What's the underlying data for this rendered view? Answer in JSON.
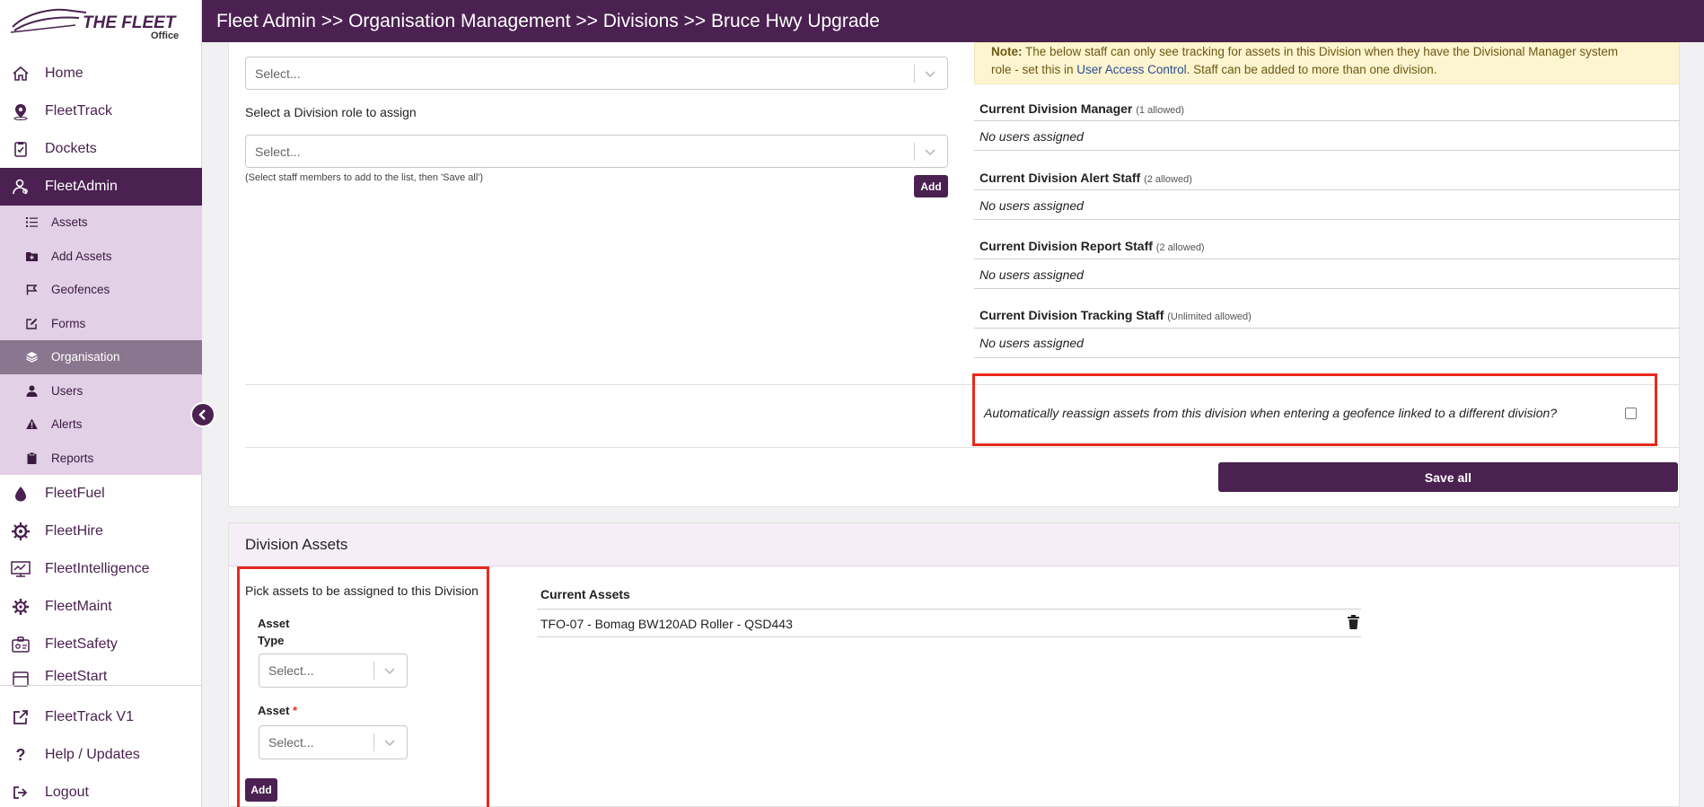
{
  "app": {
    "logo_text": "THE FLEET",
    "logo_sub": "Office"
  },
  "header": {
    "breadcrumb": "Fleet Admin >> Organisation Management >> Divisions >> Bruce Hwy Upgrade"
  },
  "sidebar": {
    "items": [
      {
        "label": "Home",
        "icon": "home-icon"
      },
      {
        "label": "FleetTrack",
        "icon": "map-pin-icon"
      },
      {
        "label": "Dockets",
        "icon": "clipboard-icon"
      },
      {
        "label": "FleetAdmin",
        "icon": "admin-user-icon"
      }
    ],
    "sub_items": [
      {
        "label": "Assets",
        "icon": "list-icon"
      },
      {
        "label": "Add Assets",
        "icon": "folder-plus-icon"
      },
      {
        "label": "Geofences",
        "icon": "flag-icon"
      },
      {
        "label": "Forms",
        "icon": "edit-icon"
      },
      {
        "label": "Organisation",
        "icon": "layers-icon"
      },
      {
        "label": "Users",
        "icon": "user-icon"
      },
      {
        "label": "Alerts",
        "icon": "warning-icon"
      },
      {
        "label": "Reports",
        "icon": "clipboard-solid-icon"
      }
    ],
    "products": [
      {
        "label": "FleetFuel",
        "icon": "fuel-drop-icon"
      },
      {
        "label": "FleetHire",
        "icon": "hire-gear-icon"
      },
      {
        "label": "FleetIntelligence",
        "icon": "monitor-chart-icon"
      },
      {
        "label": "FleetMaint",
        "icon": "cog-icon"
      },
      {
        "label": "FleetSafety",
        "icon": "safety-badge-icon"
      },
      {
        "label": "FleetStart",
        "icon": "start-calendar-icon"
      }
    ],
    "bottom": [
      {
        "label": "FleetTrack V1",
        "icon": "external-link-icon"
      },
      {
        "label": "Help / Updates",
        "icon": "question-icon"
      },
      {
        "label": "Logout",
        "icon": "logout-icon"
      }
    ]
  },
  "staff_form": {
    "select_staff_placeholder": "Select...",
    "role_label": "Select a Division role to assign",
    "select_role_placeholder": "Select...",
    "hint": "(Select staff members to add to the list, then 'Save all')",
    "add_label": "Add"
  },
  "note": {
    "prefix": "Note:",
    "text1": " The below staff can only see tracking for assets in this Division when they have the Divisional Manager system",
    "text2": "role - set this in ",
    "link": "User Access Control",
    "text3": ". Staff can be added to more than one division."
  },
  "staff_sections": [
    {
      "title": "Current Division Manager",
      "limit": "(1 allowed)",
      "value": "No users assigned"
    },
    {
      "title": "Current Division Alert Staff",
      "limit": "(2 allowed)",
      "value": "No users assigned"
    },
    {
      "title": "Current Division Report Staff",
      "limit": "(2 allowed)",
      "value": "No users assigned"
    },
    {
      "title": "Current Division Tracking Staff",
      "limit": "(Unlimited allowed)",
      "value": "No users assigned"
    }
  ],
  "auto_reassign": {
    "label": "Automatically reassign assets from this division when entering a geofence linked to a different division?",
    "checked": false
  },
  "save_all": "Save all",
  "division_assets": {
    "title": "Division Assets",
    "pick_label": "Pick assets to be assigned to this Division",
    "asset_type_label": "Asset Type",
    "asset_type_line1": "Asset",
    "asset_type_line2": "Type",
    "asset_type_placeholder": "Select...",
    "asset_label": "Asset",
    "required_mark": "*",
    "asset_placeholder": "Select...",
    "add_label": "Add",
    "current_title": "Current Assets",
    "current": [
      {
        "label": "TFO-07 - Bomag BW120AD Roller - QSD443"
      }
    ]
  },
  "colors": {
    "brand": "#4a2150",
    "submenu_bg": "#e1d0e6",
    "highlight": "#e8291c"
  }
}
